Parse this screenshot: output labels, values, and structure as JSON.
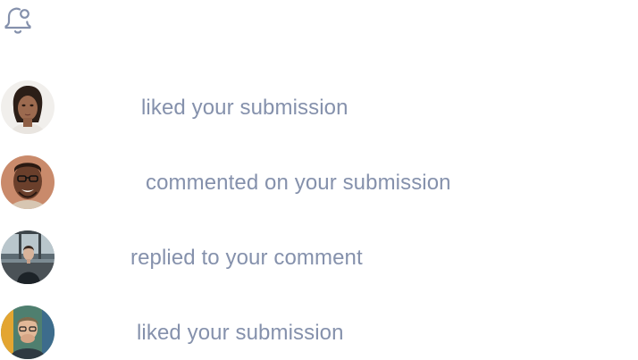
{
  "header": {
    "icon": "bell-settings-icon"
  },
  "notifications": [
    {
      "avatar_icon": "avatar-woman",
      "message": "liked your submission"
    },
    {
      "avatar_icon": "avatar-man-glasses",
      "message": "commented on your submission"
    },
    {
      "avatar_icon": "avatar-man-window",
      "message": "replied to your comment"
    },
    {
      "avatar_icon": "avatar-person-hands",
      "message": "liked your submission"
    }
  ],
  "colors": {
    "text": "#8591ac",
    "icon": "#8591ac",
    "background": "#ffffff"
  }
}
